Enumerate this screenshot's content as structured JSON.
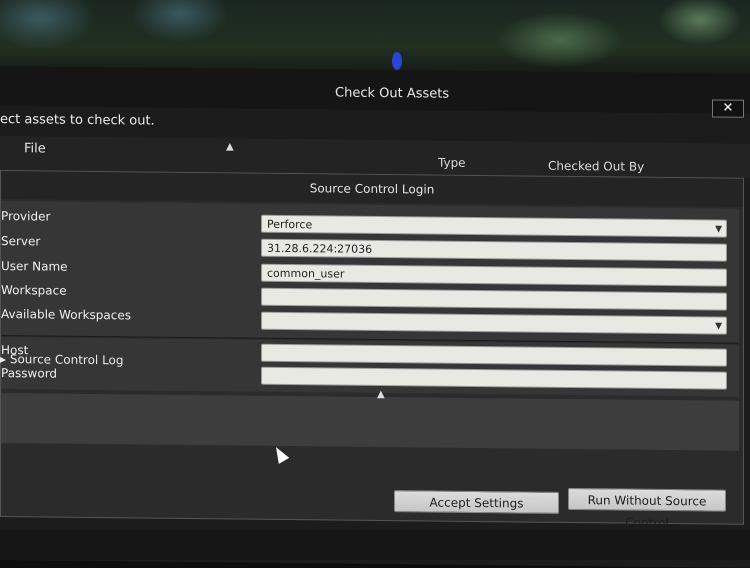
{
  "window": {
    "title": "Check Out Assets",
    "close_glyph": "✕"
  },
  "instructions": "ect assets to check out.",
  "table": {
    "columns": [
      "File",
      "Type",
      "Checked Out By"
    ],
    "sort_glyph": "▲"
  },
  "login": {
    "title": "Source Control Login",
    "fields": [
      {
        "label": "Provider",
        "value": "Perforce",
        "kind": "dropdown"
      },
      {
        "label": "Server",
        "value": "31.28.6.224:27036",
        "kind": "text"
      },
      {
        "label": "User Name",
        "value": "common_user",
        "kind": "text"
      },
      {
        "label": "Workspace",
        "value": "",
        "kind": "text"
      },
      {
        "label": "Available Workspaces",
        "value": "",
        "kind": "dropdown"
      }
    ],
    "advanced_fields": [
      {
        "label": "Host",
        "value": ""
      },
      {
        "label": "Password",
        "value": ""
      }
    ],
    "expander_glyph": "▲",
    "log_label": "Source Control Log",
    "buttons": {
      "accept": "Accept Settings",
      "run_without": "Run Without Source Control"
    }
  },
  "icons": {
    "dropdown": "chevron-down-icon",
    "close": "close-icon",
    "sort": "sort-ascending-icon"
  }
}
